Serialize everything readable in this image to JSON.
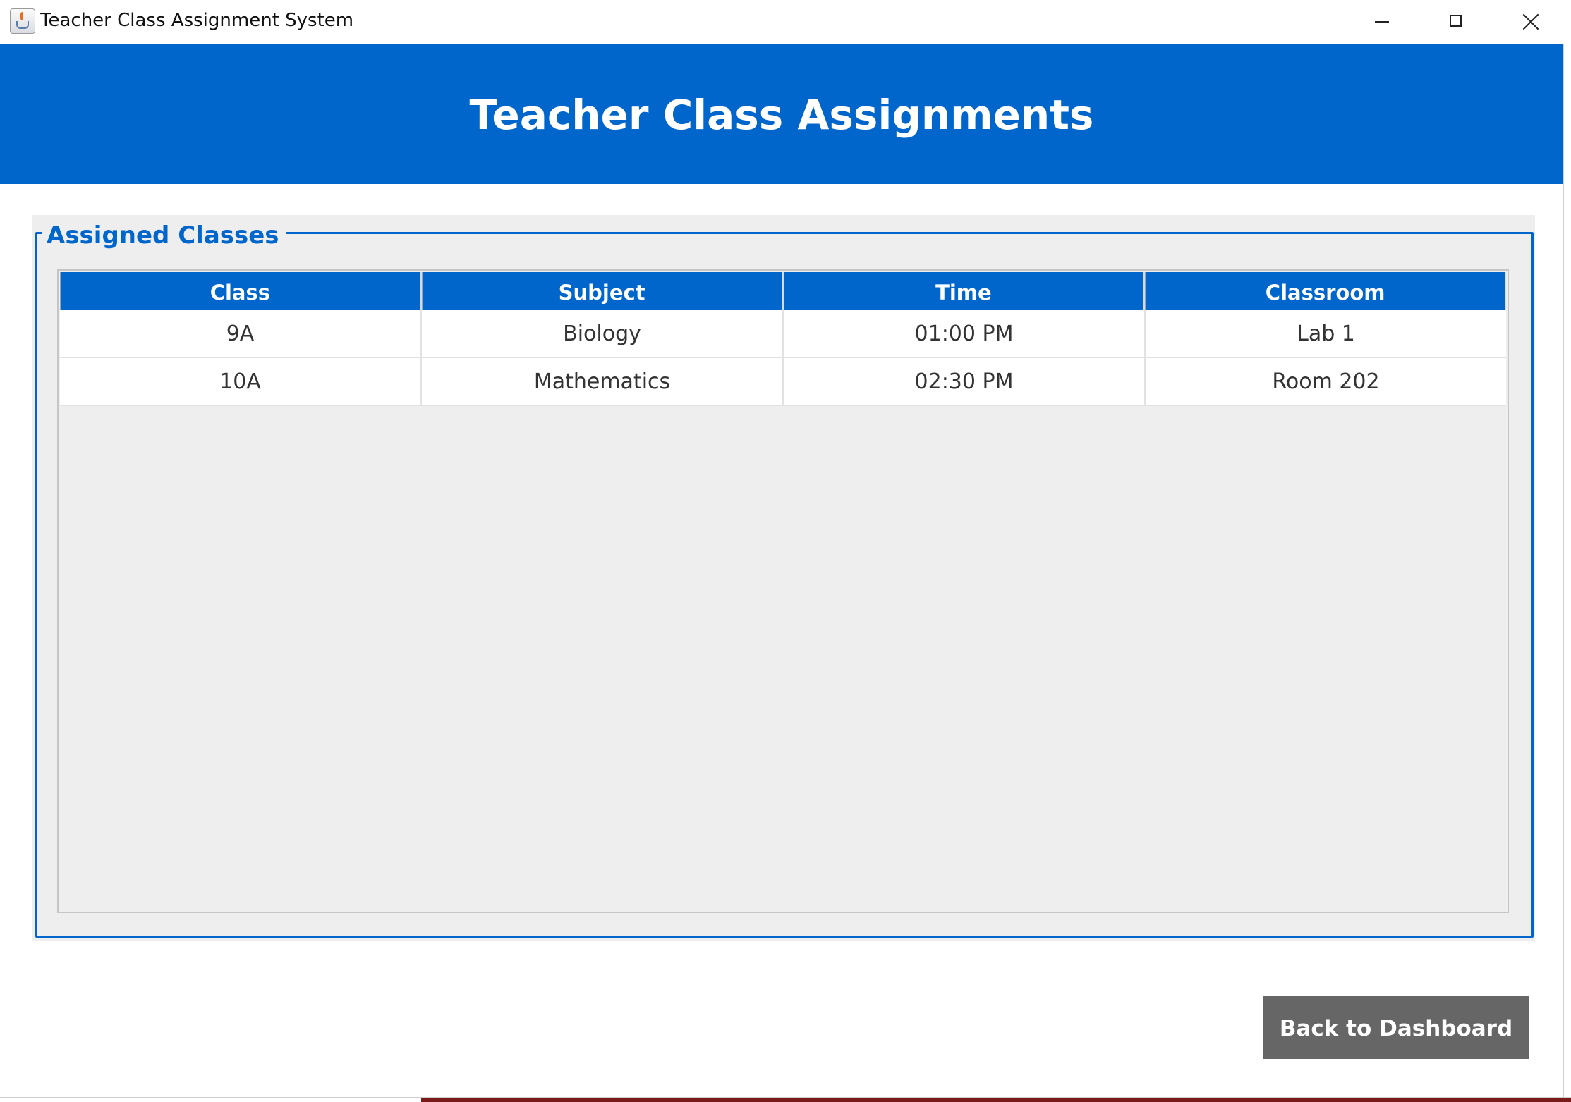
{
  "window": {
    "title": "Teacher Class Assignment System",
    "icon": "java-cup-icon"
  },
  "header": {
    "title": "Teacher Class Assignments",
    "background": "#0066cc"
  },
  "panel": {
    "legend": "Assigned Classes",
    "accent": "#0066cc"
  },
  "table": {
    "columns": [
      "Class",
      "Subject",
      "Time",
      "Classroom"
    ],
    "rows": [
      [
        "9A",
        "Biology",
        "01:00 PM",
        "Lab 1"
      ],
      [
        "10A",
        "Mathematics",
        "02:30 PM",
        "Room 202"
      ]
    ]
  },
  "actions": {
    "back_label": "Back to Dashboard",
    "back_color": "#666666"
  }
}
